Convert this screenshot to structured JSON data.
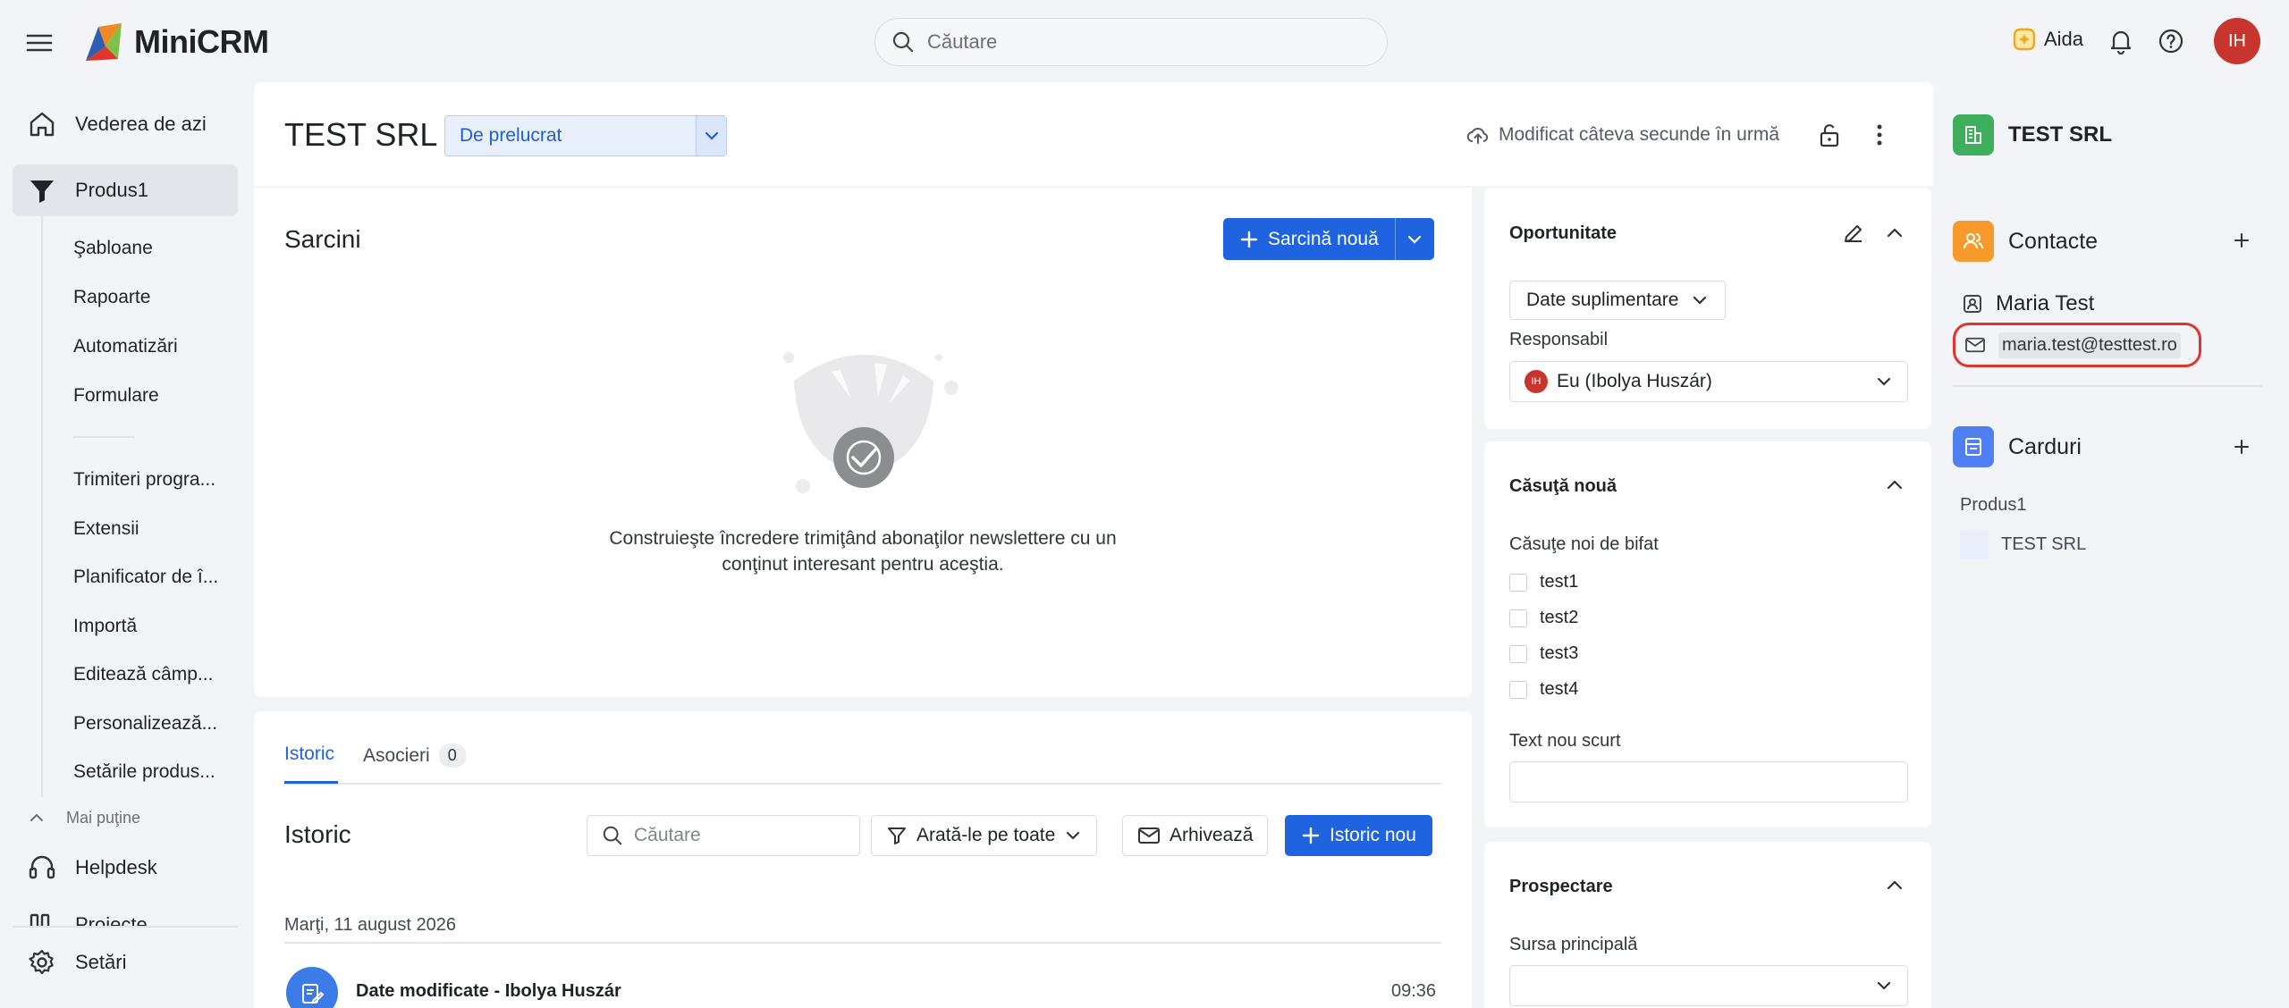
{
  "app": {
    "name": "MiniCRM"
  },
  "topbar": {
    "search_placeholder": "Căutare",
    "aida_label": "Aida",
    "avatar_initials": "IH"
  },
  "sidebar": {
    "items": [
      {
        "label": "Vederea de azi",
        "icon": "home-icon"
      },
      {
        "label": "Produs1",
        "icon": "funnel-icon",
        "active": true
      }
    ],
    "sub_items": [
      "Şabloane",
      "Rapoarte",
      "Automatizări",
      "Formulare",
      "Trimiteri progra...",
      "Extensii",
      "Planificator de î...",
      "Importă",
      "Editează câmp...",
      "Personalizează...",
      "Setările produs..."
    ],
    "less_label": "Mai puţine",
    "bottom_items": [
      {
        "label": "Helpdesk",
        "icon": "headset-icon"
      },
      {
        "label": "Proiecte",
        "icon": "columns-icon"
      }
    ],
    "settings_label": "Setări"
  },
  "header": {
    "title": "TEST SRL",
    "status": "De prelucrat",
    "modified": "Modificat câteva secunde în urmă"
  },
  "tasks": {
    "title": "Sarcini",
    "new_task_label": "Sarcină nouă",
    "empty_text": "Construieşte încredere trimiţând abonaţilor newslettere cu un conţinut interesant pentru aceştia."
  },
  "history": {
    "tabs": [
      {
        "label": "Istoric"
      },
      {
        "label": "Asocieri",
        "count": "0"
      }
    ],
    "title": "Istoric",
    "search_placeholder": "Căutare",
    "filter_label": "Arată-le pe toate",
    "archive_label": "Arhivează",
    "new_label": "Istoric nou",
    "date": "Marţi, 11 august 2026",
    "entry_title": "Date modificate - Ibolya Huszár",
    "entry_time": "09:36"
  },
  "opportunity": {
    "title": "Oportunitate",
    "extra_data_label": "Date suplimentare",
    "responsible_label": "Responsabil",
    "responsible_initials": "IH",
    "responsible_value": "Eu (Ibolya Huszár)"
  },
  "new_box": {
    "title": "Căsuţă nouă",
    "checkbox_group_label": "Căsuţe noi de bifat",
    "checkboxes": [
      "test1",
      "test2",
      "test3",
      "test4"
    ],
    "short_text_label": "Text nou scurt"
  },
  "prospecting": {
    "title": "Prospectare",
    "source_label": "Sursa principală"
  },
  "right_panel": {
    "company": "TEST SRL",
    "contacts_title": "Contacte",
    "contact_name": "Maria Test",
    "contact_email": "maria.test@testtest.ro",
    "cards_title": "Carduri",
    "product_label": "Produs1",
    "card_name": "TEST SRL"
  },
  "colors": {
    "accent_blue": "#1f63e0",
    "avatar_red": "#c8352d",
    "highlight_red": "#e0352b",
    "company_green": "#3fae5c",
    "contacts_orange": "#f59a2b",
    "cards_blue": "#4f7ff0"
  }
}
